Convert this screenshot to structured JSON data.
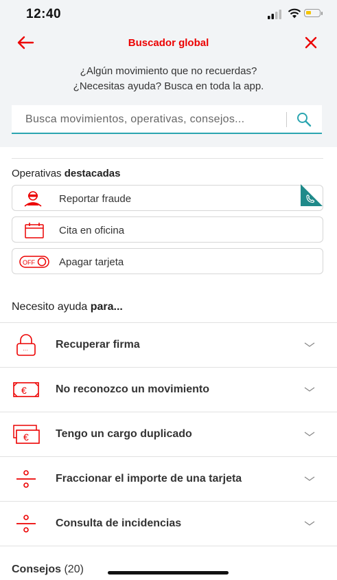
{
  "status_bar": {
    "time": "12:40"
  },
  "header": {
    "title": "Buscador global"
  },
  "help_text": {
    "line1": "¿Algún movimiento que no recuerdas?",
    "line2": "¿Necesitas ayuda? Busca en toda la app."
  },
  "search": {
    "placeholder": "Busca movimientos, operativas, consejos..."
  },
  "operativas": {
    "title_plain": "Operativas ",
    "title_bold": "destacadas",
    "items": [
      {
        "label": "Reportar fraude",
        "icon": "fraud-thief-icon"
      },
      {
        "label": "Cita en oficina",
        "icon": "calendar-icon"
      },
      {
        "label": "Apagar tarjeta",
        "icon": "card-off-toggle-icon"
      }
    ],
    "badge_icon": "phone-call-icon",
    "toggle_text": "OFF"
  },
  "ayuda": {
    "title_plain": "Necesito ayuda ",
    "title_bold": "para...",
    "items": [
      {
        "label": "Recuperar firma",
        "icon": "padlock-icon"
      },
      {
        "label": "No reconozco un movimiento",
        "icon": "euro-banknote-icon"
      },
      {
        "label": "Tengo un cargo duplicado",
        "icon": "duplicate-banknote-icon"
      },
      {
        "label": "Fraccionar el importe de una tarjeta",
        "icon": "division-icon"
      },
      {
        "label": "Consulta de incidencias",
        "icon": "division-icon"
      }
    ]
  },
  "consejos": {
    "label": "Consejos",
    "count": "(20)"
  },
  "colors": {
    "brand": "#ec0000",
    "accent": "#2aa5b0",
    "badge": "#1f8a8a"
  }
}
